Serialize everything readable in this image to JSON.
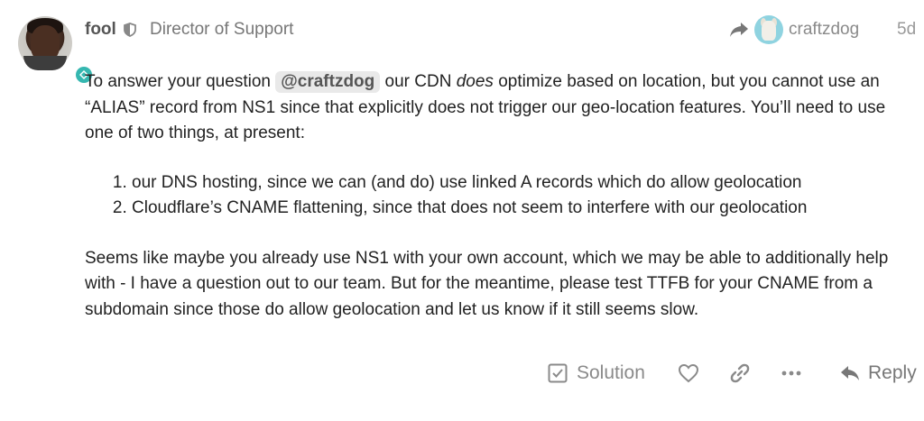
{
  "post": {
    "author": {
      "username": "fool",
      "title": "Director of Support",
      "avatar_icon": "user-avatar",
      "flair_icon": "netlify-flair-icon",
      "moderator_icon": "shield-icon"
    },
    "reply_to": {
      "username": "craftzdog",
      "icon": "share-arrow-icon"
    },
    "date": "5d",
    "body": {
      "p1_before": "To answer your question ",
      "mention": "@craftzdog",
      "p1_mid": " our CDN ",
      "p1_em": "does",
      "p1_after": " optimize based on location, but you cannot use an “ALIAS” record from NS1 since that explicitly does not trigger our geo-location features. You’ll need to use one of two things, at present:",
      "list": [
        "our DNS hosting, since we can (and do) use linked A records which do allow geolocation",
        "Cloudflare’s CNAME flattening, since that does not seem to interfere with our geolocation"
      ],
      "p2": "Seems like maybe you already use NS1 with your own account, which we may be able to additionally help with - I have a question out to our team. But for the meantime, please test TTFB for your CNAME from a subdomain since those do allow geolocation and let us know if it still seems slow."
    },
    "actions": {
      "solution_label": "Solution",
      "reply_label": "Reply"
    }
  }
}
